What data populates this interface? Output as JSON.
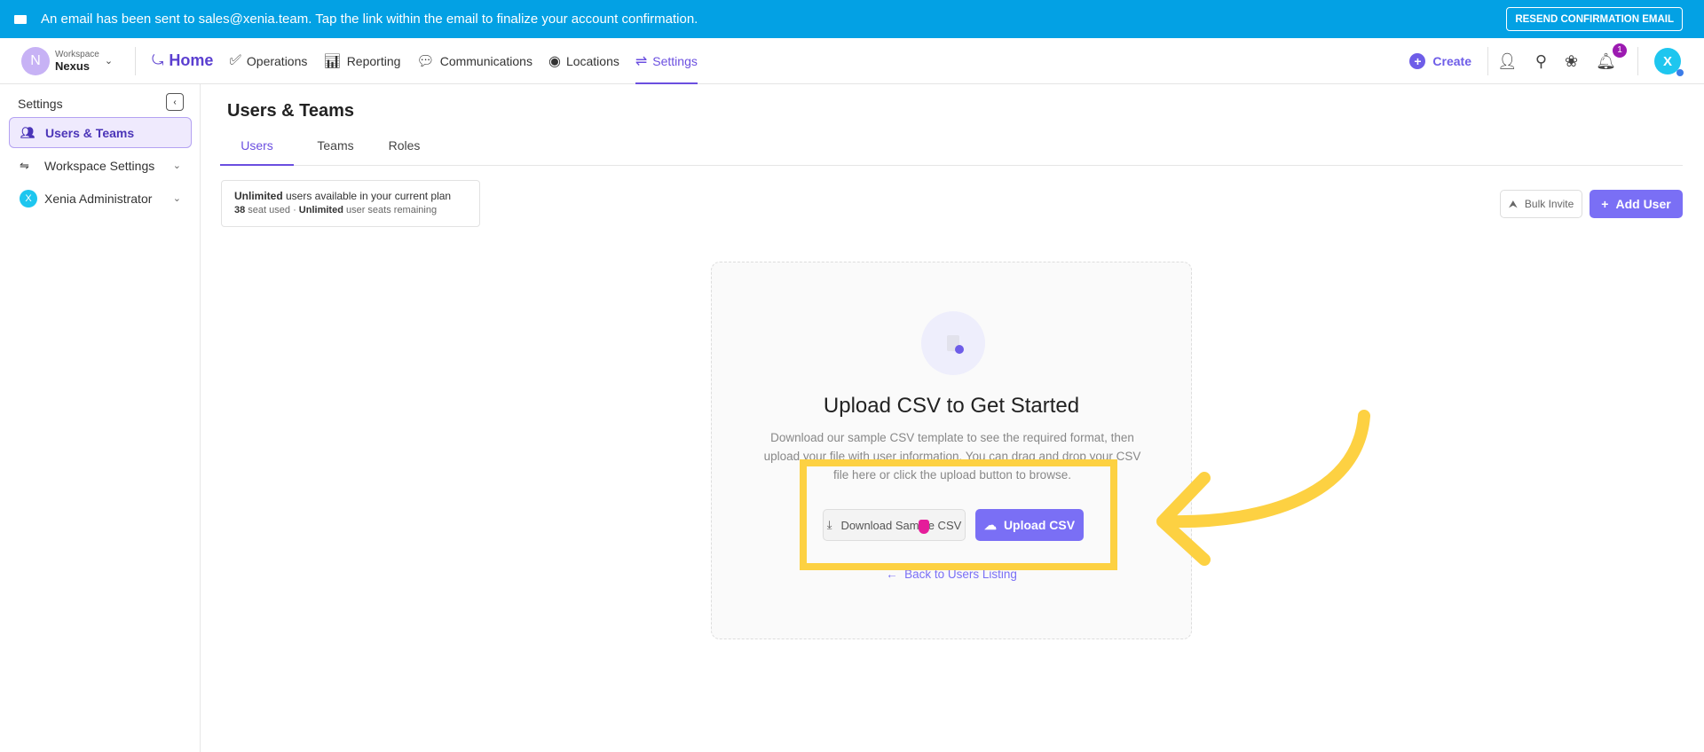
{
  "banner": {
    "message": "An email has been sent to sales@xenia.team. Tap the link within the email to finalize your account confirmation.",
    "button": "RESEND CONFIRMATION EMAIL"
  },
  "workspace": {
    "initial": "N",
    "label": "Workspace",
    "name": "Nexus"
  },
  "nav": {
    "home": "Home",
    "items": [
      "Operations",
      "Reporting",
      "Communications",
      "Locations",
      "Settings"
    ],
    "create": "Create",
    "notif_count": "1",
    "user_initial": "X"
  },
  "sidebar": {
    "title": "Settings",
    "items": [
      {
        "label": "Users & Teams"
      },
      {
        "label": "Workspace Settings"
      },
      {
        "label": "Xenia Administrator",
        "initial": "X"
      }
    ]
  },
  "main": {
    "title": "Users & Teams",
    "tabs": [
      "Users",
      "Teams",
      "Roles"
    ],
    "plan": {
      "bold1": "Unlimited",
      "text1": " users available in your current plan",
      "count": "38",
      "text2": " seat used · ",
      "bold2": "Unlimited",
      "text3": " user seats remaining"
    },
    "bulk_invite": "Bulk Invite",
    "add_user": "Add User"
  },
  "upload": {
    "heading": "Upload CSV to Get Started",
    "description": "Download our sample CSV template to see the required format, then upload your file with user information. You can drag and drop your CSV file here or click the upload button to browse.",
    "download": "Download Sample CSV",
    "upload": "Upload CSV",
    "back": "Back to Users Listing"
  },
  "colors": {
    "accent": "#7a6ff5",
    "banner": "#03a1e4",
    "highlight": "#fdd142"
  }
}
